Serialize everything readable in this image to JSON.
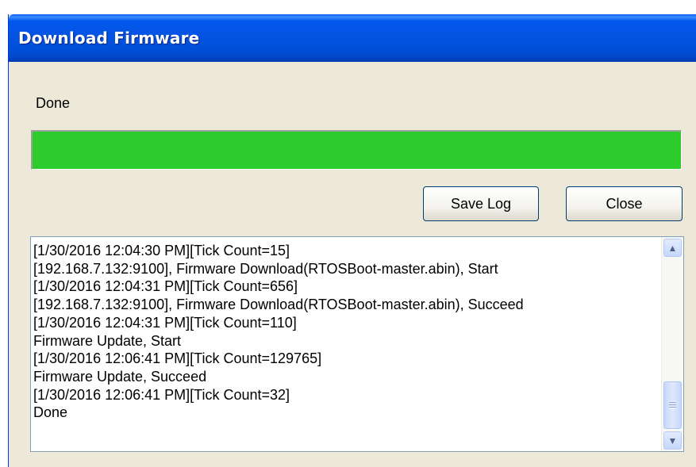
{
  "window": {
    "title": "Download Firmware"
  },
  "status": {
    "text": "Done",
    "progress_percent": 100,
    "progress_color": "#2ccc2c"
  },
  "buttons": {
    "save_log_label": "Save Log",
    "close_label": "Close"
  },
  "log": {
    "lines": [
      "[1/30/2016 12:04:30 PM][Tick Count=15]",
      "[192.168.7.132:9100], Firmware Download(RTOSBoot-master.abin), Start",
      "[1/30/2016 12:04:31 PM][Tick Count=656]",
      "[192.168.7.132:9100], Firmware Download(RTOSBoot-master.abin), Succeed",
      "[1/30/2016 12:04:31 PM][Tick Count=110]",
      "Firmware Update, Start",
      "[1/30/2016 12:06:41 PM][Tick Count=129765]",
      "Firmware Update, Succeed",
      "[1/30/2016 12:06:41 PM][Tick Count=32]",
      "Done"
    ],
    "scrollbar": {
      "up_icon": "chevron-up-icon",
      "down_icon": "chevron-down-icon",
      "up_glyph": "▲",
      "down_glyph": "▼"
    }
  }
}
